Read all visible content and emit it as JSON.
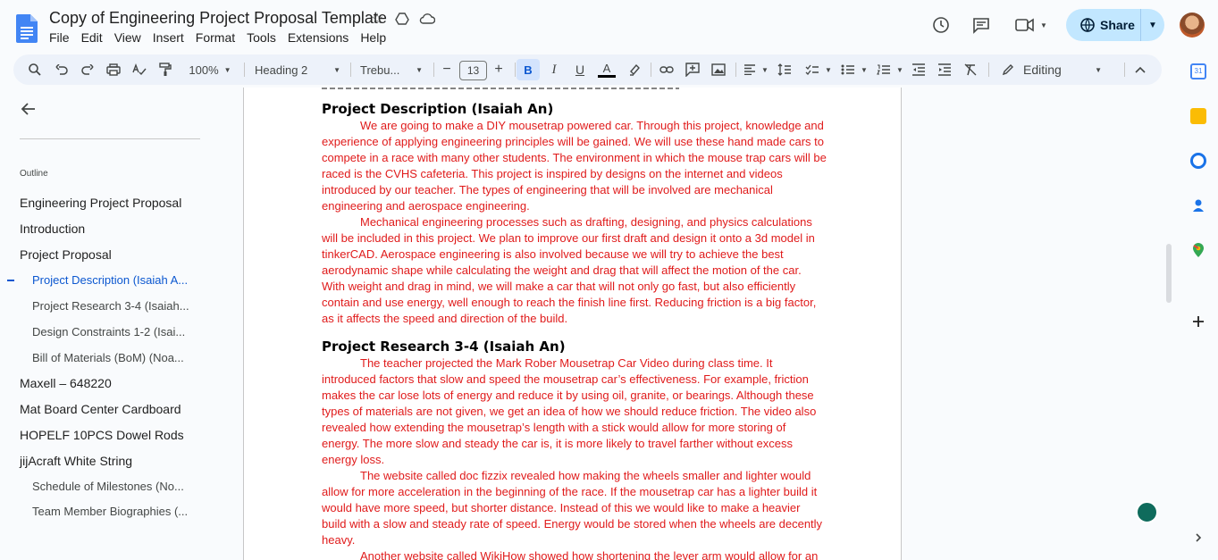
{
  "app": {
    "title": "Copy of Engineering Project Proposal Template",
    "menus": [
      "File",
      "Edit",
      "View",
      "Insert",
      "Format",
      "Tools",
      "Extensions",
      "Help"
    ],
    "share_label": "Share"
  },
  "toolbar": {
    "zoom": "100%",
    "style": "Heading 2",
    "font": "Trebu...",
    "font_size": "13",
    "bold": "B",
    "italic": "I",
    "underline": "U",
    "text_color": "A",
    "mode": "Editing",
    "minus": "−",
    "plus": "+"
  },
  "sidebar": {
    "outline_label": "Outline",
    "items": [
      {
        "label": "Engineering Project Proposal",
        "level": 1
      },
      {
        "label": "Introduction",
        "level": 1
      },
      {
        "label": "Project Proposal",
        "level": 1
      },
      {
        "label": "Project Description (Isaiah A...",
        "level": 2,
        "active": true
      },
      {
        "label": "Project Research 3-4 (Isaiah...",
        "level": 2
      },
      {
        "label": "Design Constraints 1-2 (Isai...",
        "level": 2
      },
      {
        "label": "Bill of Materials (BoM) (Noa...",
        "level": 2
      },
      {
        "label": "Maxell – 648220",
        "level": 1
      },
      {
        "label": "Mat Board Center Cardboard",
        "level": 1
      },
      {
        "label": "HOPELF 10PCS Dowel Rods",
        "level": 1
      },
      {
        "label": "jijAcraft White String",
        "level": 1
      },
      {
        "label": "Schedule of Milestones (No...",
        "level": 2
      },
      {
        "label": "Team Member Biographies (...",
        "level": 2
      }
    ]
  },
  "document": {
    "h1": "Project Description (Isaiah An)",
    "p1": "We are going to make a DIY mousetrap powered car. Through this project, knowledge and experience of applying engineering principles will be gained. We will use these hand made cars to compete in a race with many other students. The environment in which the mouse trap cars will be raced is the CVHS cafeteria. This project is inspired by designs on the internet and videos introduced by our teacher. The types of engineering that will be involved are mechanical engineering and aerospace engineering.",
    "p2": "Mechanical engineering processes such as drafting, designing, and physics calculations will be included in this project. We plan to improve our first draft and design it onto a 3d model in tinkerCAD. Aerospace engineering is also involved because we will try to achieve the best aerodynamic shape while calculating the weight and drag that will affect the motion of the car. With weight and drag in mind, we will make a car that will not only go fast, but also efficiently contain and use energy, well enough to reach the finish line first. Reducing friction is a big factor, as it affects the speed and direction of the build.",
    "h2": "Project Research 3-4 (Isaiah An)",
    "p3": "The teacher projected the Mark Rober Mousetrap Car Video during class time. It introduced factors that slow and speed the mousetrap car’s effectiveness. For example, friction makes the car lose lots of energy and reduce it by using oil, granite, or bearings. Although these types of materials are not given, we get an idea of how we should reduce friction. The video also revealed how extending the mousetrap’s length with a stick would allow for more storing of energy. The more slow and steady the car is, it is more likely to travel farther without excess energy loss.",
    "p4": "The website called doc fizzix revealed how making the wheels smaller and lighter would allow for more acceleration in the beginning of the race. If the mousetrap car has a lighter build it would have more speed, but shorter distance. Instead of this we would like to make a heavier build with a slow and steady rate of speed. Energy would be stored when the wheels are decently heavy.",
    "p5": "Another website called WikiHow showed how shortening the lever arm would allow for an"
  },
  "colors": {
    "accent": "#0b57d0",
    "body_text": "#e01b1b",
    "share_bg": "#c2e7ff",
    "toolbar_bg": "#edf2fa"
  }
}
